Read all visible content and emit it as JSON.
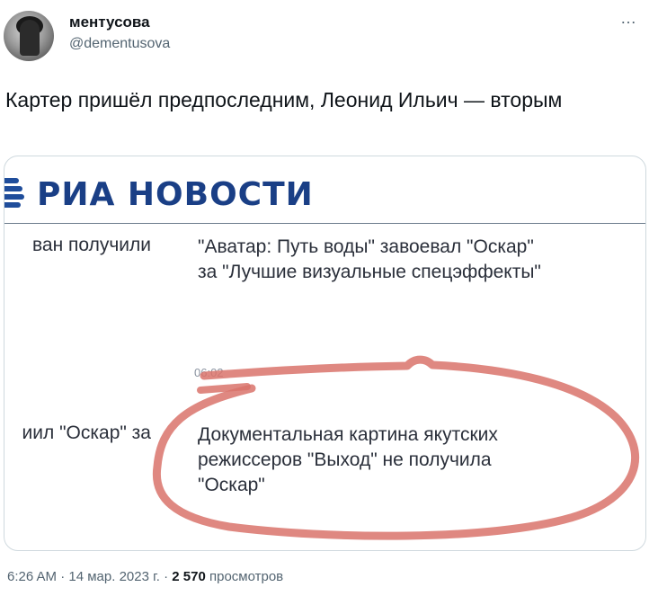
{
  "user": {
    "display_name": "ментусова",
    "handle": "@dementusova"
  },
  "more_icon": "…",
  "tweet_text": "Картер пришёл предпоследним, Леонид Ильич — вторым",
  "media": {
    "logo_text": "РИА НОВОСТИ",
    "row1_left": "ван получили",
    "row1_headline_line1": "\"Аватар: Путь воды\" завоевал \"Оскар\"",
    "row1_headline_line2": "за \"Лучшие визуальные спецэффекты\"",
    "time": "06:02",
    "row2_left": "иил \"Оскар\" за",
    "row2_headline_line1": "Документальная картина якутских",
    "row2_headline_line2": "режиссеров \"Выход\" не получила",
    "row2_headline_line3": "\"Оскар\"",
    "highlight_color": "#d9736b",
    "brand_color": "#1a3f86"
  },
  "footer": {
    "time": "6:26 AM",
    "date": "14 мар. 2023 г.",
    "views_count": "2 570",
    "views_label": "просмотров"
  }
}
